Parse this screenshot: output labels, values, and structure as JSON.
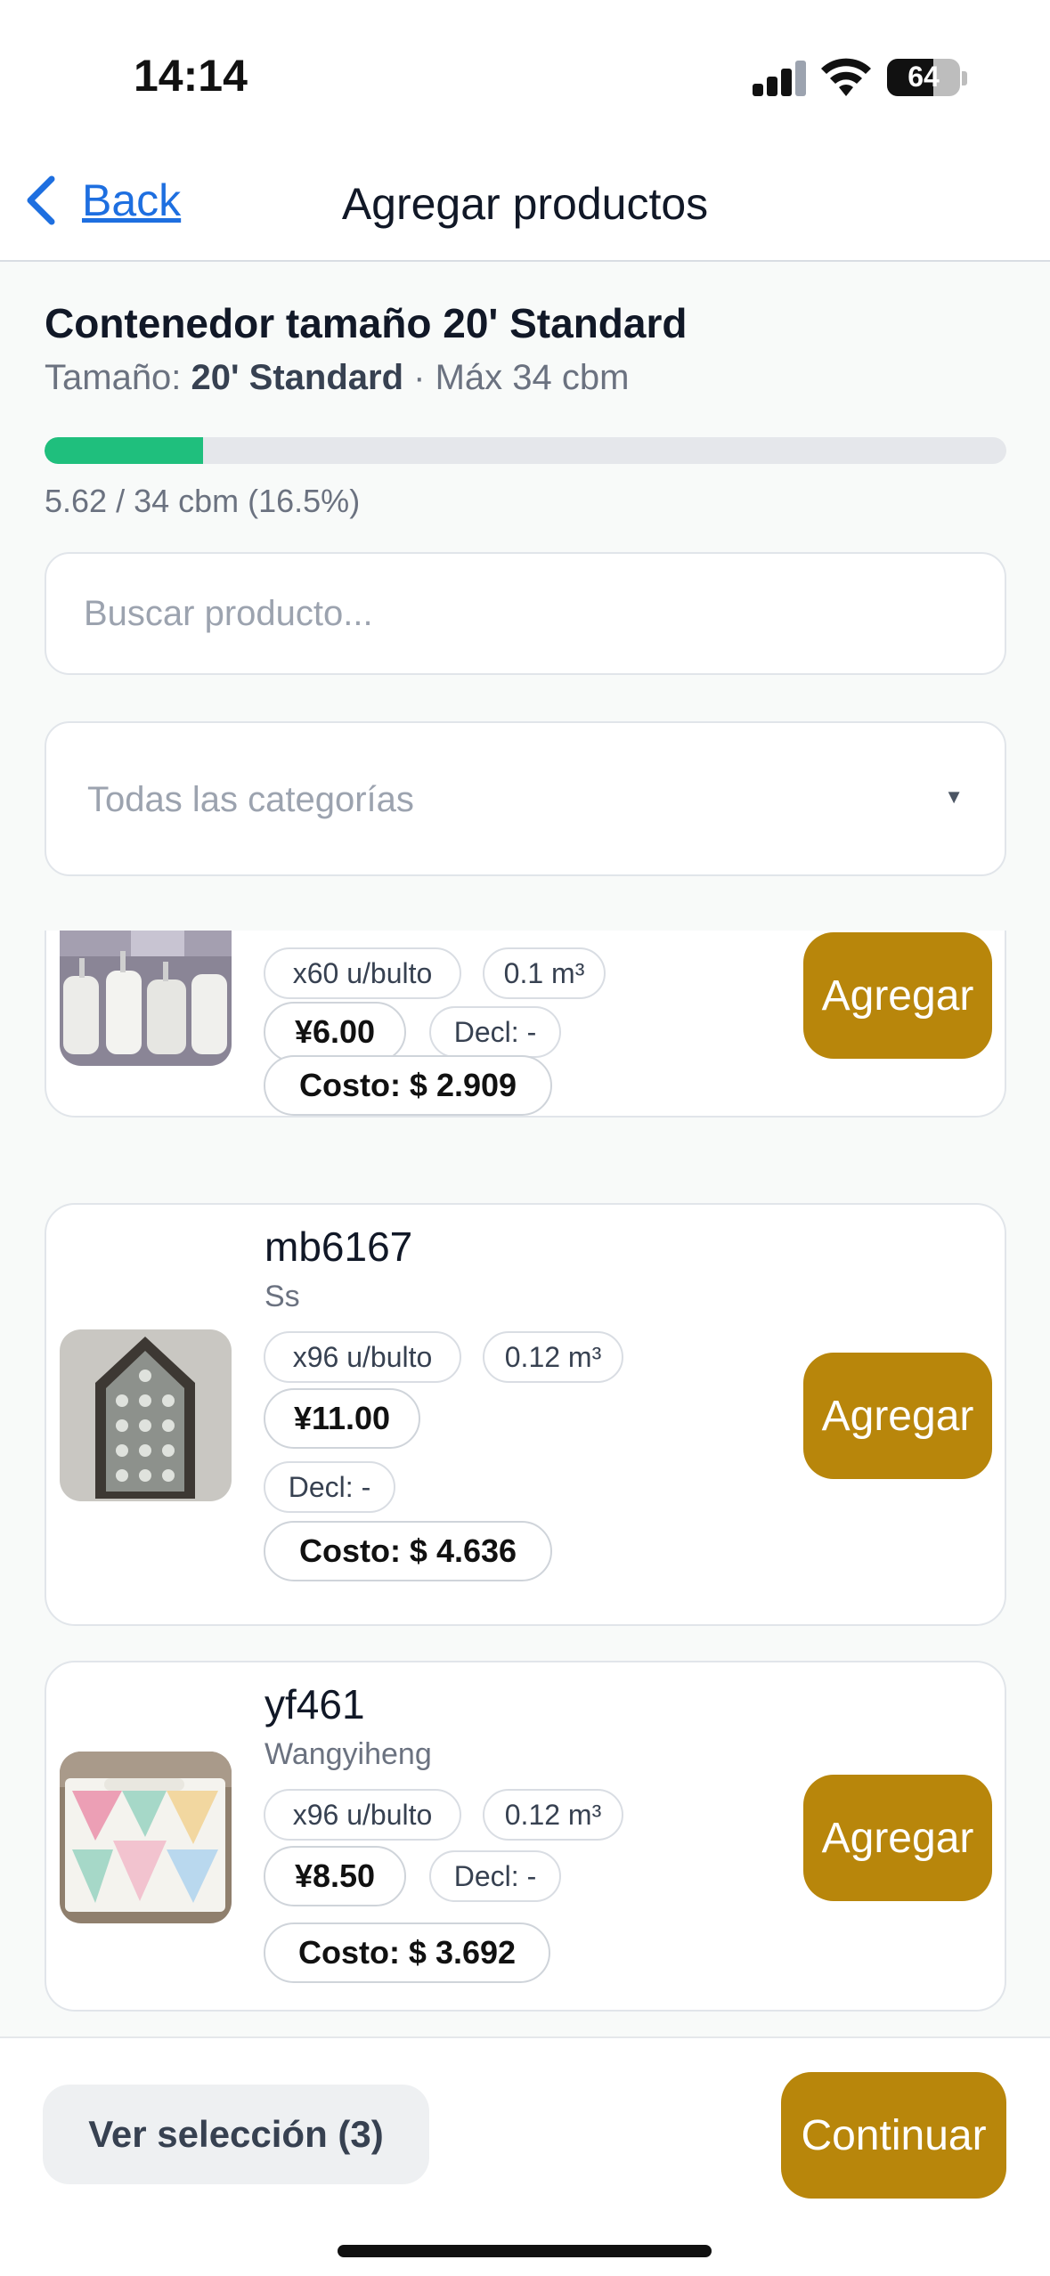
{
  "status_bar": {
    "time": "14:14",
    "battery": "64"
  },
  "nav": {
    "back_label": "Back",
    "title": "Agregar productos"
  },
  "container": {
    "title": "Contenedor tamaño 20' Standard",
    "size_prefix": "Tamaño:",
    "size_value": "20' Standard",
    "max_text": "· Máx 34 cbm",
    "progress_fraction": 0.165,
    "progress_text": "5.62 / 34 cbm (16.5%)"
  },
  "search": {
    "placeholder": "Buscar producto..."
  },
  "category": {
    "selected": "Todas las categorías",
    "caret": "▼"
  },
  "products": [
    {
      "name": "",
      "brand": "",
      "units": "x60 u/bulto",
      "volume": "0.1 m³",
      "price": "¥6.00",
      "declared": "Decl: -",
      "cost": "Costo: $ 2.909",
      "add_label": "Agregar"
    },
    {
      "name": "mb6167",
      "brand": "Ss",
      "units": "x96 u/bulto",
      "volume": "0.12 m³",
      "price": "¥11.00",
      "declared": "Decl: -",
      "cost": "Costo: $ 4.636",
      "add_label": "Agregar"
    },
    {
      "name": "yf461",
      "brand": "Wangyiheng",
      "units": "x96 u/bulto",
      "volume": "0.12 m³",
      "price": "¥8.50",
      "declared": "Decl: -",
      "cost": "Costo: $ 3.692",
      "add_label": "Agregar"
    }
  ],
  "footer": {
    "view_selection": "Ver selección (3)",
    "continue": "Continuar"
  },
  "colors": {
    "accent": "#b8860b",
    "progress": "#1fbf7d",
    "link": "#1e6fe0"
  }
}
